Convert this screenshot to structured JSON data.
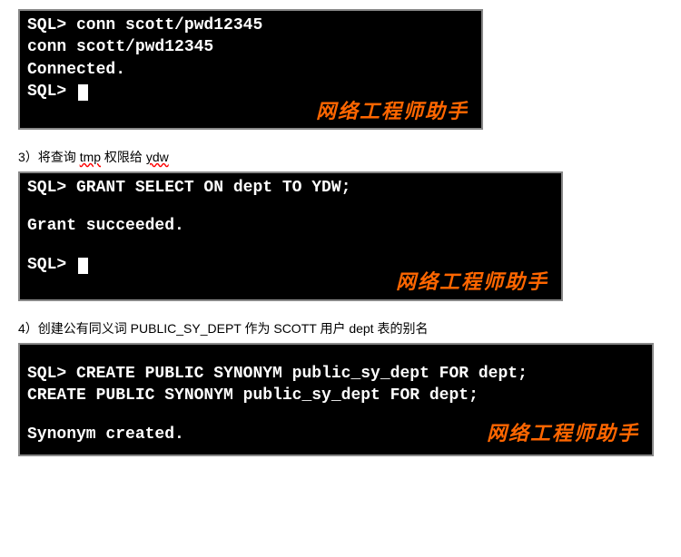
{
  "terminal1": {
    "line1": "SQL> conn scott/pwd12345",
    "line2": "conn scott/pwd12345",
    "line3": "Connected.",
    "line4_prompt": "SQL> ",
    "watermark": "网络工程师助手"
  },
  "caption1": {
    "prefix": "3）将查询 ",
    "tmp": "tmp",
    "mid": " 权限给 ",
    "ydw": "ydw"
  },
  "terminal2": {
    "line1": "SQL> GRANT SELECT ON dept TO YDW;",
    "line2": "Grant succeeded.",
    "line3_prompt": "SQL> ",
    "watermark": "网络工程师助手"
  },
  "caption2": {
    "text": "4）创建公有同义词 PUBLIC_SY_DEPT 作为 SCOTT 用户 dept 表的别名"
  },
  "terminal3": {
    "line1": "SQL> CREATE PUBLIC SYNONYM public_sy_dept FOR dept;",
    "line2": "CREATE PUBLIC SYNONYM public_sy_dept FOR dept;",
    "line3": "Synonym created.",
    "watermark": "网络工程师助手"
  }
}
